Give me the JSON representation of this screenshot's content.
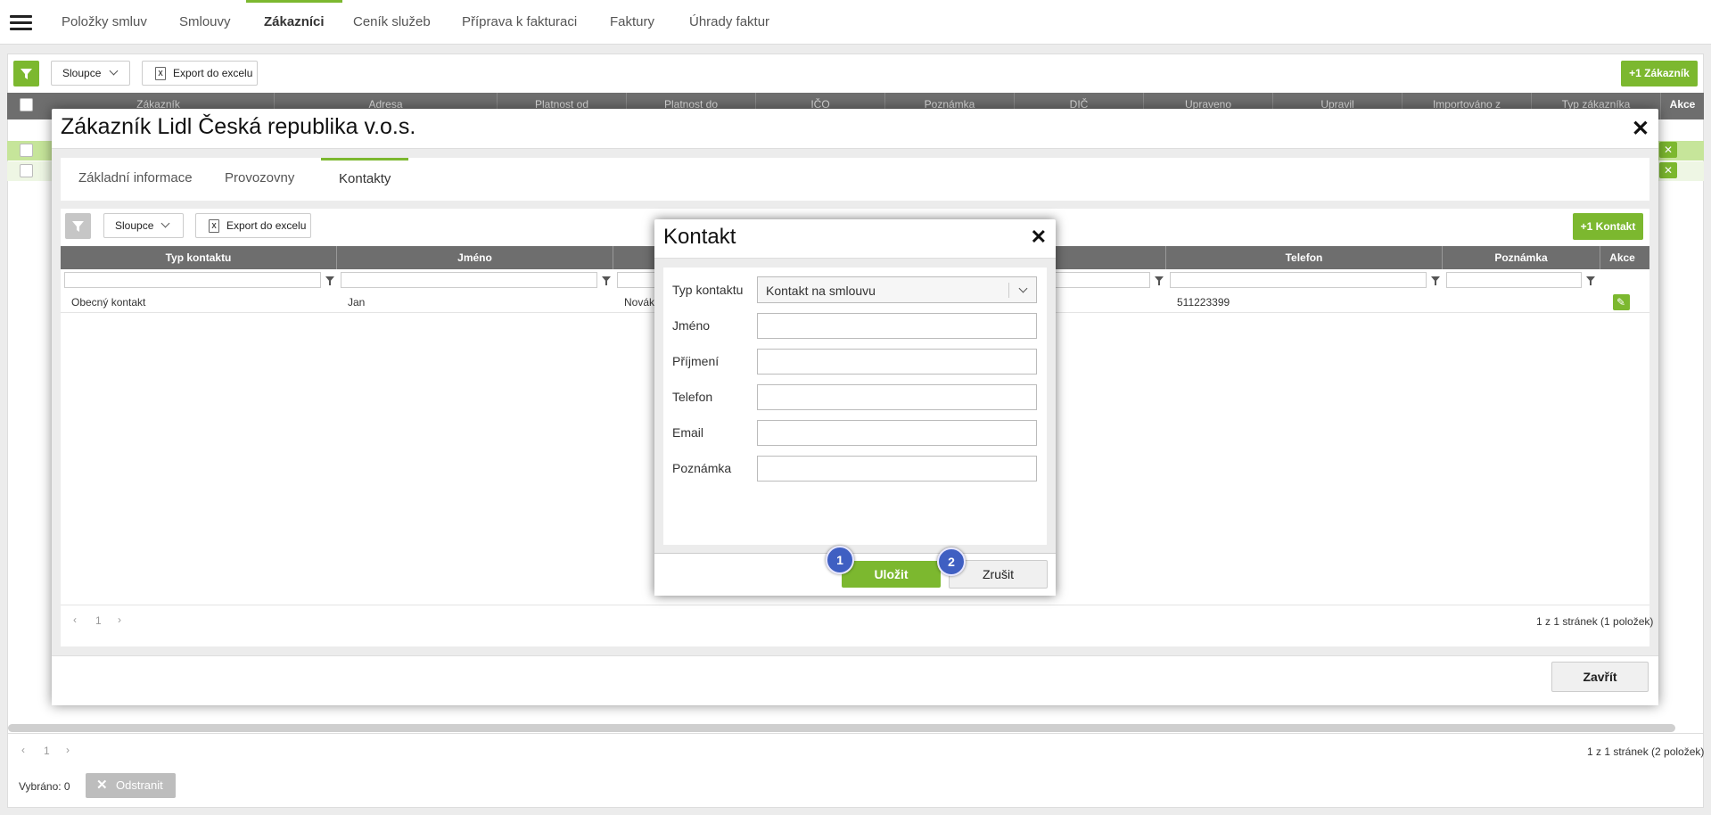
{
  "colors": {
    "accent": "#7cb82f",
    "header_bg": "#6e6e6e",
    "badge": "#3f5fc2"
  },
  "topnav": {
    "menu_icon": "hamburger-icon",
    "tabs": [
      {
        "label": "Položky smluv",
        "active": false
      },
      {
        "label": "Smlouvy",
        "active": false
      },
      {
        "label": "Zákazníci",
        "active": true
      },
      {
        "label": "Ceník služeb",
        "active": false
      },
      {
        "label": "Příprava k fakturaci",
        "active": false
      },
      {
        "label": "Faktury",
        "active": false
      },
      {
        "label": "Úhrady faktur",
        "active": false
      }
    ]
  },
  "toolbar": {
    "columns_label": "Sloupce",
    "export_label": "Export do excelu",
    "add_customer_label": "+1 Zákazník"
  },
  "bg_table": {
    "columns": [
      "Zákazník",
      "Adresa",
      "Platnost od",
      "Platnost do",
      "IČO",
      "Poznámka",
      "DIČ",
      "Upraveno",
      "Upravil",
      "Importováno z",
      "Typ zákazníka",
      "Akce"
    ]
  },
  "footer": {
    "page": "1",
    "page_info": "1 z 1 stránek (2 položek)",
    "selected": "Vybráno: 0",
    "delete_label": "Odstranit"
  },
  "customer_modal": {
    "title": "Zákazník Lidl Česká republika v.o.s.",
    "tabs": [
      {
        "label": "Základní informace",
        "active": false
      },
      {
        "label": "Provozovny",
        "active": false
      },
      {
        "label": "Kontakty",
        "active": true
      }
    ],
    "toolbar": {
      "columns_label": "Sloupce",
      "export_label": "Export do excelu",
      "add_contact_label": "+1 Kontakt"
    },
    "table": {
      "columns": [
        "Typ kontaktu",
        "Jméno",
        "Telefon",
        "Poznámka",
        "Akce"
      ],
      "rows": [
        {
          "typ": "Obecný kontakt",
          "jmeno": "Jan",
          "prijmeni": "Novák",
          "telefon": "511223399",
          "poznamka": ""
        }
      ]
    },
    "page": "1",
    "page_info": "1 z 1 stránek (1 položek)",
    "close_label": "Zavřít"
  },
  "contact_dialog": {
    "title": "Kontakt",
    "fields": {
      "typ_label": "Typ kontaktu",
      "typ_value": "Kontakt na smlouvu",
      "jmeno_label": "Jméno",
      "prijmeni_label": "Příjmení",
      "telefon_label": "Telefon",
      "email_label": "Email",
      "poznamka_label": "Poznámka"
    },
    "save_label": "Uložit",
    "cancel_label": "Zrušit",
    "badges": [
      "1",
      "2"
    ]
  }
}
